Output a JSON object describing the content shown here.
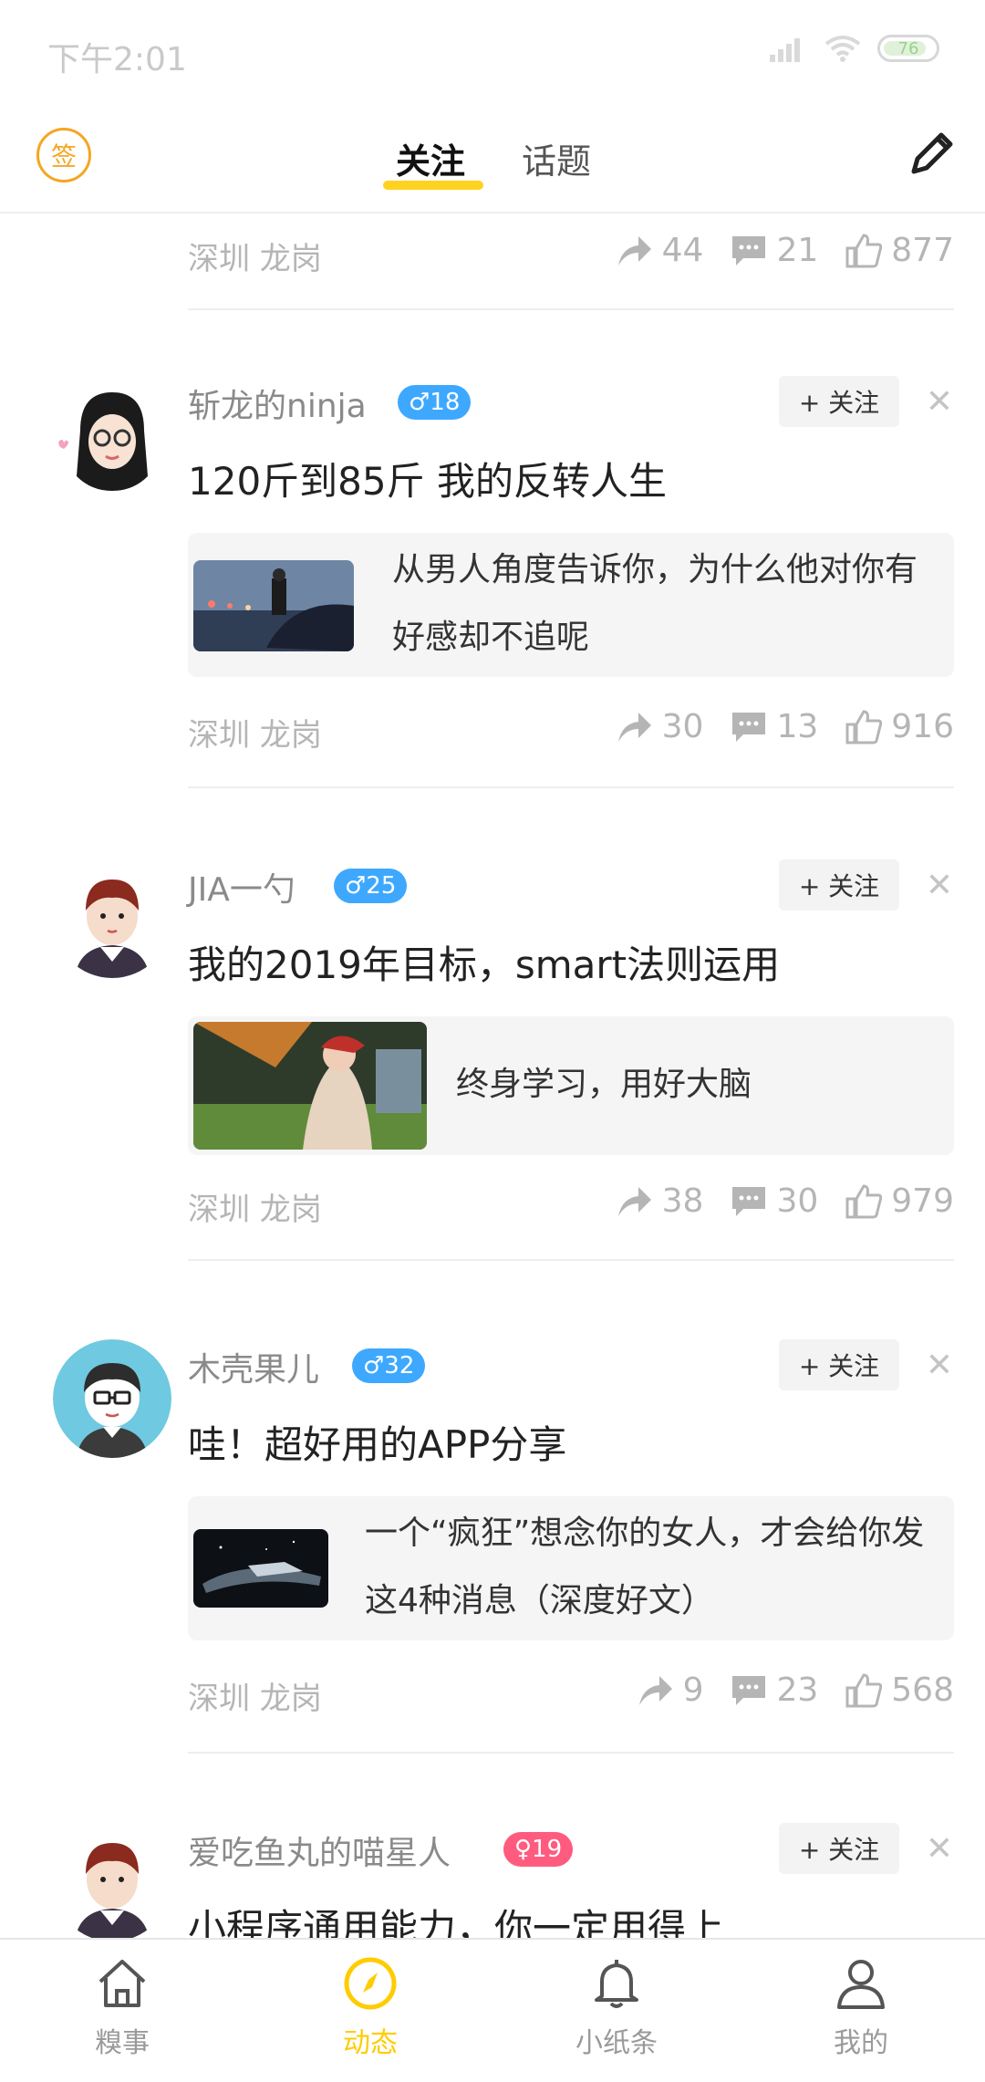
{
  "status": {
    "time": "下午2:01",
    "battery": "76"
  },
  "header": {
    "sign_label": "签",
    "tabs": [
      {
        "label": "关注",
        "active": true
      },
      {
        "label": "话题",
        "active": false
      }
    ]
  },
  "follow_label": "+ 关注",
  "top_stub": {
    "location": "深圳 龙岗",
    "shares": "44",
    "comments": "21",
    "likes": "877"
  },
  "posts": [
    {
      "username": "斩龙的ninja",
      "gender": "male",
      "age": "♂18",
      "title": "120斤到85斤 我的反转人生",
      "card_text": "从男人角度告诉你，为什么他对你有好感却不追呢",
      "location": "深圳 龙岗",
      "shares": "30",
      "comments": "13",
      "likes": "916"
    },
    {
      "username": "JIA一勺",
      "gender": "male",
      "age": "♂25",
      "title": "我的2019年目标，smart法则运用",
      "card_text": "终身学习，用好大脑",
      "location": "深圳 龙岗",
      "shares": "38",
      "comments": "30",
      "likes": "979"
    },
    {
      "username": "木壳果儿",
      "gender": "male",
      "age": "♂32",
      "title": "哇！超好用的APP分享",
      "card_text": "一个“疯狂”想念你的女人，才会给你发这4种消息（深度好文）",
      "location": "深圳 龙岗",
      "shares": "9",
      "comments": "23",
      "likes": "568"
    },
    {
      "username": "爱吃鱼丸的喵星人",
      "gender": "female",
      "age": "♀19",
      "title": "小程序通用能力，你一定用得上"
    }
  ],
  "nav": [
    {
      "label": "糗事",
      "icon": "home-icon",
      "active": false
    },
    {
      "label": "动态",
      "icon": "compass-icon",
      "active": true
    },
    {
      "label": "小纸条",
      "icon": "bell-icon",
      "active": false
    },
    {
      "label": "我的",
      "icon": "person-icon",
      "active": false
    }
  ],
  "colors": {
    "accent": "#ffd21f",
    "nav_active": "#ffcc00",
    "sign": "#f5a623",
    "male_badge": "#3ea8ff",
    "female_badge": "#ff5b7f"
  }
}
